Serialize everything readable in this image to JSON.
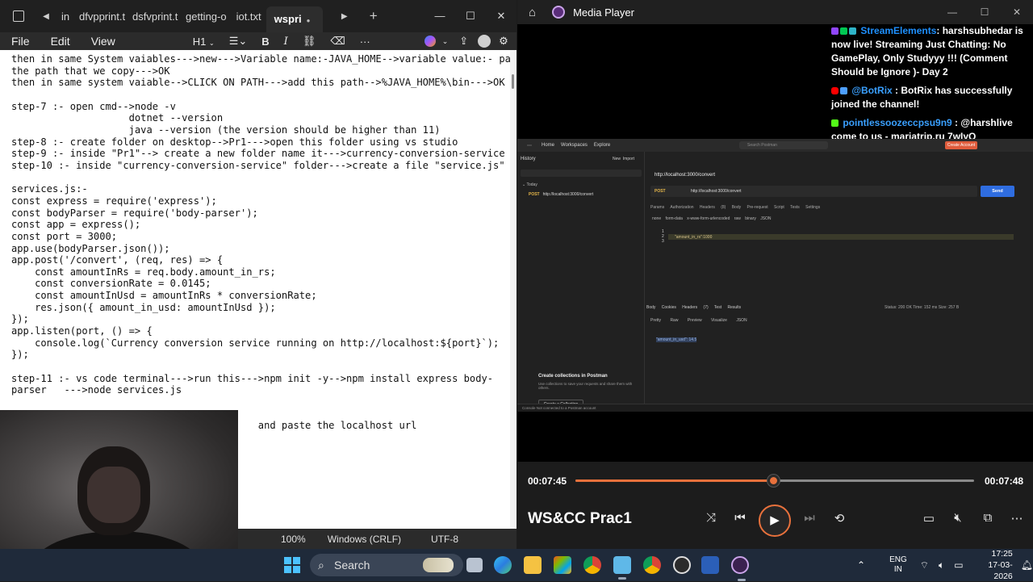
{
  "notepad": {
    "tabs": [
      {
        "label": "in"
      },
      {
        "label": "dfvpprint.t"
      },
      {
        "label": "dsfvprint.t"
      },
      {
        "label": "getting-o"
      },
      {
        "label": "iot.txt"
      },
      {
        "label": "wspri"
      }
    ],
    "new_tab_label": "+",
    "menus": {
      "file": "File",
      "edit": "Edit",
      "view": "View"
    },
    "heading_selector": "H1",
    "content_lines": [
      "then in same System vaiables--->new--->Variable name:-JAVA_HOME-->variable value:- paste",
      "the path that we copy--->OK",
      "then in same system vaiable-->CLICK ON PATH--->add this path-->%JAVA_HOME%\\bin--->OK",
      "",
      "step-7 :- open cmd-->node -v",
      "                    dotnet --version",
      "                    java --version (the version should be higher than 11)",
      "step-8 :- create folder on desktop-->Pr1--->open this folder using vs studio",
      "step-9 :- inside \"Pr1\"--> create a new folder name it--->currency-conversion-service",
      "step-10 :- inside \"currency-conversion-service\" folder--->create a file \"service.js\"",
      "",
      "services.js:-",
      "const express = require('express');",
      "const bodyParser = require('body-parser');",
      "const app = express();",
      "const port = 3000;",
      "app.use(bodyParser.json());",
      "app.post('/convert', (req, res) => {",
      "    const amountInRs = req.body.amount_in_rs;",
      "    const conversionRate = 0.0145;",
      "    const amountInUsd = amountInRs * conversionRate;",
      "    res.json({ amount_in_usd: amountInUsd });",
      "});",
      "app.listen(port, () => {",
      "    console.log(`Currency conversion service running on http://localhost:${port}`);",
      "});",
      "",
      "step-11 :- vs code terminal--->run this--->npm init -y-->npm install express body-",
      "parser   --->node services.js",
      "",
      "",
      "                                          and paste the localhost url"
    ],
    "status": {
      "zoom": "100%",
      "line_ending": "Windows (CRLF)",
      "encoding": "UTF-8"
    }
  },
  "player": {
    "app_title": "Media Player",
    "chat": [
      {
        "user": "StreamElements",
        "user_color": "#1e90ff",
        "text": ": harshsubhedar is now live! Streaming Just Chatting: No GamePlay, Only Studyyy !!! (Comment Should be Ignore )- Day 2"
      },
      {
        "user": "@BotRix",
        "user_color": "#3aa0ff",
        "text": " : BotRix has successfully joined the channel!"
      },
      {
        "user": "pointlessoozeccpsu9n9",
        "user_color": "#3aa0ff",
        "text": " : @harshlive come to us - mariatrip.ru 7wIyQ"
      }
    ],
    "postman": {
      "nav": [
        "Home",
        "Workspaces",
        "Explore"
      ],
      "search_placeholder": "Search Postman",
      "create_account": "Create Account",
      "history_label": "History",
      "new_label": "New",
      "import_label": "Import",
      "today_label": "Today",
      "history_item_method": "POST",
      "history_item_url": "http://localhost:3000/convert",
      "request_title": "http://localhost:3000/convert",
      "method": "POST",
      "url": "http://localhost:3000/convert",
      "send_label": "Send",
      "request_tabs": "Params  Authorization  Headers (8)  Body  Pre-request Script  Tests  Settings",
      "body_modes": "none  form-data  x-www-form-urlencoded  raw  binary  JSON",
      "request_body": "\"amount_in_rs\":1000",
      "response_tabs": "Body  Cookies  Headers (7)  Test Results",
      "response_status": "200 OK",
      "response_meta": "Status: 200 OK   Time: 152 ms   Size: 257 B",
      "save_response": "Save Response",
      "response_views": "Pretty  Raw  Preview  Visualize  JSON",
      "response_body": "\"amount_in_usd\": 14.5",
      "collections_title": "Create collections in Postman",
      "collections_desc": "Use collections to save your requests and share them with others.",
      "collections_btn": "Create a Collection",
      "statusbar": "Console   Not connected to a Postman account"
    },
    "time_current": "00:07:45",
    "time_total": "00:07:48",
    "progress": 0.495,
    "media_title": "WS&CC Prac1",
    "accent": "#e8713c"
  },
  "taskbar": {
    "search_label": "Search",
    "language": "ENG",
    "region": "IN",
    "time": "17:25",
    "date": "17-03-2026"
  }
}
